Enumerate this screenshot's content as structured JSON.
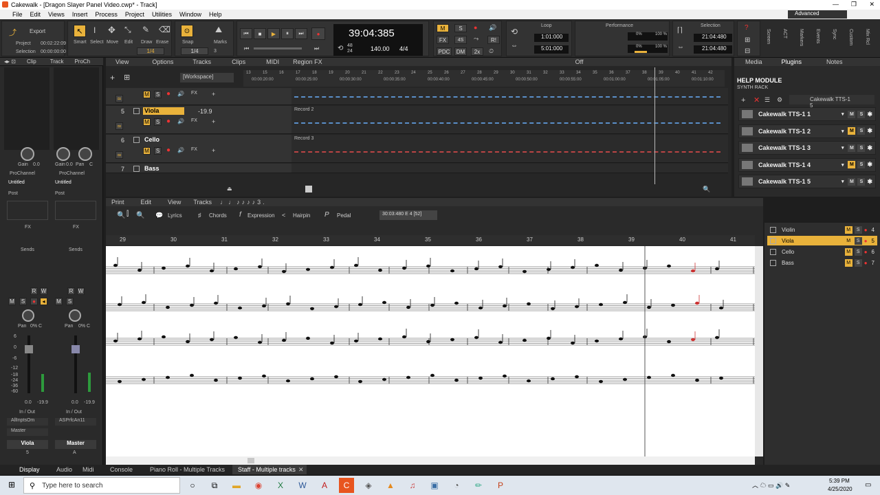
{
  "window": {
    "title": "Cakewalk - [Dragon Slayer Panel Video.cwp* - Track]",
    "controls": [
      "—",
      "❐",
      "✕"
    ]
  },
  "menu": [
    "File",
    "Edit",
    "Views",
    "Insert",
    "Process",
    "Project",
    "Utilities",
    "Window",
    "Help"
  ],
  "workspace": "Advanced",
  "control_bar": {
    "export": "Export",
    "project_label": "Project",
    "project_time": "00:02:22:09",
    "selection_label": "Selection",
    "selection_time": "00:00:00:00",
    "tools": [
      "Smart",
      "Select",
      "Move",
      "Edit",
      "Draw",
      "Erase"
    ],
    "snap": "Snap",
    "marks": "Marks",
    "snap_val": "1/4",
    "snap_val2": "1/4",
    "snap_num": "3",
    "time": "39:04:385",
    "tempo": "140.00",
    "meter": "4/4",
    "meter_top": "48",
    "meter_bot": "24",
    "mix": {
      "m": "M",
      "s": "S",
      "fx": "FX",
      "pdc": "PDC",
      "dm": "DM",
      "x2": "2x",
      "r": "R!"
    },
    "loop_label": "Loop",
    "loop_start": "1:01:000",
    "loop_end": "5:01:000",
    "perf_label": "Performance",
    "perf1": "0%",
    "perf2": "100 %",
    "perf3": "0%",
    "perf4": "100 %",
    "sel_label": "Selection",
    "sel_start": "21:04:480",
    "sel_end": "21:04:480",
    "help_label": "HELP MODULE",
    "side_tabs": [
      "Screen",
      "ACT",
      "Markers",
      "Events",
      "Sync",
      "Custom",
      "Mix Rcl"
    ]
  },
  "inspector": {
    "tabs": [
      "Clip",
      "Track",
      "ProCh"
    ],
    "gain_label": "Gain",
    "gain_val": "0.0",
    "gain2_label": "Gain",
    "gain2_val": "0.0",
    "pan_label": "Pan",
    "pan_val": "C",
    "prochannel": "ProChannel",
    "untitled": "Untitled",
    "post": "Post",
    "fx": "FX",
    "sends": "Sends",
    "pan_a": "Pan",
    "pan_a_val": "0% C",
    "pan_b": "Pan",
    "pan_b_val": "0% C",
    "meter_l": "0.0",
    "meter_l2": "-19.9",
    "meter_r": "0.0",
    "meter_r2": "-19.9",
    "inout": "In / Out",
    "input_l": "AllInptsOm",
    "input_r": "ASPrfcAn11",
    "out_l": "Master",
    "name_l": "Viola",
    "name_r": "Master",
    "num_l": "5",
    "num_r": "A",
    "scale": [
      "6",
      "0",
      "-6",
      "-12",
      "-18",
      "-24",
      "-36",
      "-60"
    ]
  },
  "track_view": {
    "menus": [
      "View",
      "Options",
      "Tracks",
      "Clips",
      "MIDI",
      "Region FX"
    ],
    "workspace": "[Workspace]",
    "off": "Off",
    "ruler": [
      "13",
      "15",
      "16",
      "17",
      "18",
      "19",
      "20",
      "21",
      "22",
      "23",
      "24",
      "25",
      "26",
      "27",
      "28",
      "29",
      "30",
      "31",
      "32",
      "33",
      "34",
      "35",
      "36",
      "37",
      "38",
      "39",
      "40",
      "41",
      "42"
    ],
    "times": [
      "00:00:20:00",
      "00:00:25:00",
      "00:00:30:00",
      "00:00:35:00",
      "00:00:40:00",
      "00:00:45:00",
      "00:00:50:00",
      "00:00:55:00",
      "00:01:00:00",
      "00:01:05:00",
      "00:01:10:00"
    ],
    "tracks": [
      {
        "num": "",
        "name": "",
        "vol": "",
        "fx": "FX",
        "clip": ""
      },
      {
        "num": "5",
        "name": "Viola",
        "vol": "-19.9",
        "fx": "FX",
        "clip": "Record 2"
      },
      {
        "num": "6",
        "name": "Cello",
        "vol": "",
        "fx": "FX",
        "clip": "Record 3"
      },
      {
        "num": "7",
        "name": "Bass",
        "vol": "",
        "fx": "",
        "clip": ""
      }
    ]
  },
  "right_panel": {
    "tabs": [
      "Media",
      "Plugins",
      "Notes"
    ],
    "help": "HELP MODULE",
    "synth": "SYNTH RACK",
    "synth_sel": "Cakewalk TTS-1 5",
    "synths": [
      {
        "name": "Cakewalk TTS-1 1",
        "m": "M",
        "s": "S"
      },
      {
        "name": "Cakewalk TTS-1 2",
        "m": "M",
        "s": "S"
      },
      {
        "name": "Cakewalk TTS-1 3",
        "m": "M",
        "s": "S"
      },
      {
        "name": "Cakewalk TTS-1 4",
        "m": "M",
        "s": "S"
      },
      {
        "name": "Cakewalk TTS-1 5",
        "m": "M",
        "s": "S"
      }
    ]
  },
  "staff_view": {
    "menus": [
      "Print",
      "Edit",
      "View",
      "Tracks"
    ],
    "tools": [
      "Lyrics",
      "Chords",
      "Expression",
      "Hairpin",
      "Pedal"
    ],
    "cursor": "30:03:480  E 4 [52]",
    "ruler": [
      "29",
      "30",
      "31",
      "32",
      "33",
      "34",
      "35",
      "36",
      "37",
      "38",
      "39",
      "40",
      "41"
    ],
    "tracks": [
      {
        "name": "Violin",
        "m": "M",
        "s": "S",
        "n": "4"
      },
      {
        "name": "Viola",
        "m": "M",
        "s": "S",
        "n": "5"
      },
      {
        "name": "Cello",
        "m": "M",
        "s": "S",
        "n": "6"
      },
      {
        "name": "Bass",
        "m": "M",
        "s": "S",
        "n": "7"
      }
    ]
  },
  "bottom_tabs": {
    "left": [
      "Display",
      "Audio",
      "Midi"
    ],
    "views": [
      "Console",
      "Piano Roll - Multiple Tracks",
      "Staff - Multiple tracks"
    ]
  },
  "taskbar": {
    "search": "Type here to search",
    "time": "5:39 PM",
    "date": "4/25/2020"
  }
}
